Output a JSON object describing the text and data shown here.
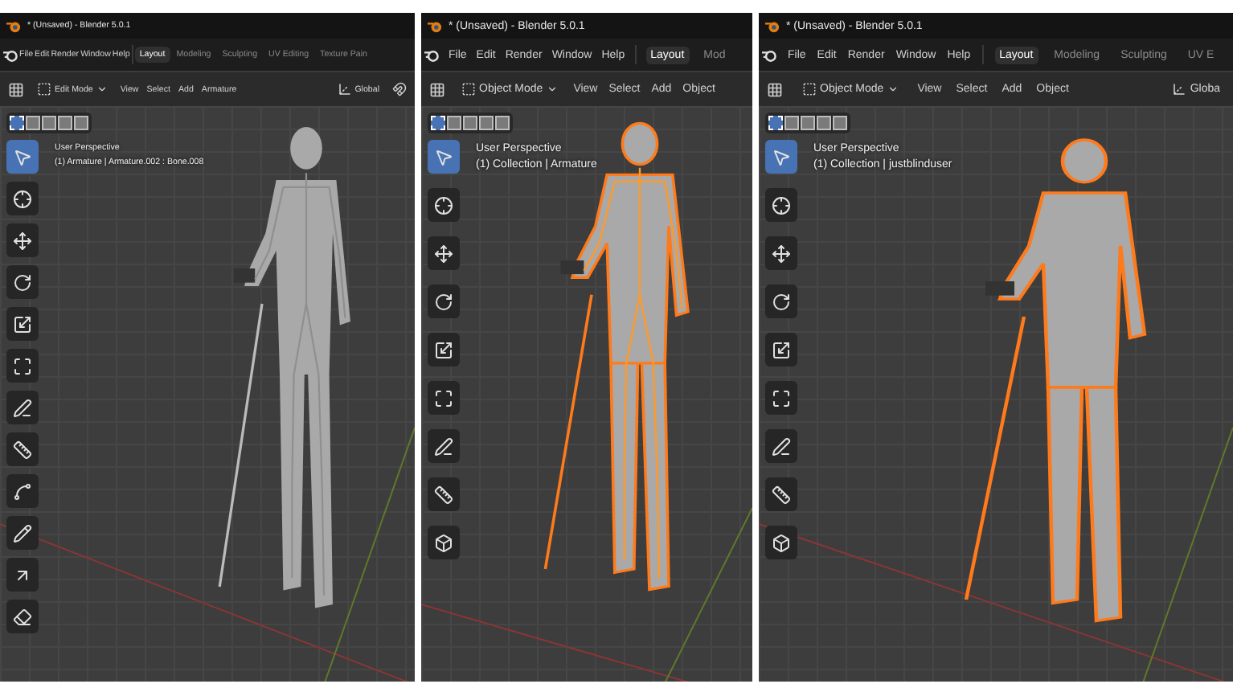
{
  "panels": [
    {
      "title": "* (Unsaved) - Blender 5.0.1",
      "menu": [
        "File",
        "Edit",
        "Render",
        "Window",
        "Help"
      ],
      "workspaces": [
        {
          "label": "Layout",
          "selected": true
        },
        {
          "label": "Modeling",
          "selected": false
        },
        {
          "label": "Sculpting",
          "selected": false
        },
        {
          "label": "UV Editing",
          "selected": false
        },
        {
          "label": "Texture Pain",
          "selected": false
        }
      ],
      "mode": "Edit Mode",
      "header_menu": [
        "View",
        "Select",
        "Add",
        "Armature"
      ],
      "orientation": "Global",
      "view_title": "User Perspective",
      "view_info": "(1) Armature | Armature.002 : Bone.008",
      "outline_selected": false,
      "bones_shown": true,
      "tools": [
        {
          "kind": "select",
          "selected": true
        },
        {
          "kind": "cursor",
          "selected": false
        },
        {
          "kind": "move",
          "selected": false
        },
        {
          "kind": "rotate",
          "selected": false
        },
        {
          "kind": "scale",
          "selected": false
        },
        {
          "kind": "transform",
          "selected": false
        },
        {
          "kind": "annotate",
          "selected": false
        },
        {
          "kind": "measure",
          "selected": false
        },
        {
          "kind": "roll",
          "selected": false
        },
        {
          "kind": "bbone",
          "selected": false
        },
        {
          "kind": "extrude",
          "selected": false
        },
        {
          "kind": "envelope",
          "selected": false
        }
      ]
    },
    {
      "title": "* (Unsaved) - Blender 5.0.1",
      "menu": [
        "File",
        "Edit",
        "Render",
        "Window",
        "Help"
      ],
      "workspaces": [
        {
          "label": "Layout",
          "selected": true
        },
        {
          "label": "Mod",
          "selected": false
        }
      ],
      "mode": "Object Mode",
      "header_menu": [
        "View",
        "Select",
        "Add",
        "Object"
      ],
      "view_title": "User Perspective",
      "view_info": "(1) Collection | Armature",
      "outline_selected": true,
      "bones_shown": true,
      "tools": [
        {
          "kind": "select",
          "selected": true
        },
        {
          "kind": "cursor",
          "selected": false
        },
        {
          "kind": "move",
          "selected": false
        },
        {
          "kind": "rotate",
          "selected": false
        },
        {
          "kind": "scale",
          "selected": false
        },
        {
          "kind": "transform",
          "selected": false
        },
        {
          "kind": "annotate",
          "selected": false
        },
        {
          "kind": "measure",
          "selected": false
        },
        {
          "kind": "add_cube",
          "selected": false
        }
      ]
    },
    {
      "title": "* (Unsaved) - Blender 5.0.1",
      "menu": [
        "File",
        "Edit",
        "Render",
        "Window",
        "Help"
      ],
      "workspaces": [
        {
          "label": "Layout",
          "selected": true
        },
        {
          "label": "Modeling",
          "selected": false
        },
        {
          "label": "Sculpting",
          "selected": false
        },
        {
          "label": "UV E",
          "selected": false
        }
      ],
      "mode": "Object Mode",
      "header_menu": [
        "View",
        "Select",
        "Add",
        "Object"
      ],
      "orientation": "Globa",
      "view_title": "User Perspective",
      "view_info": "(1) Collection | justblinduser",
      "outline_selected": true,
      "bones_shown": false,
      "tools": [
        {
          "kind": "select",
          "selected": true
        },
        {
          "kind": "cursor",
          "selected": false
        },
        {
          "kind": "move",
          "selected": false
        },
        {
          "kind": "rotate",
          "selected": false
        },
        {
          "kind": "scale",
          "selected": false
        },
        {
          "kind": "transform",
          "selected": false
        },
        {
          "kind": "annotate",
          "selected": false
        },
        {
          "kind": "measure",
          "selected": false
        },
        {
          "kind": "add_cube",
          "selected": false
        }
      ]
    }
  ]
}
